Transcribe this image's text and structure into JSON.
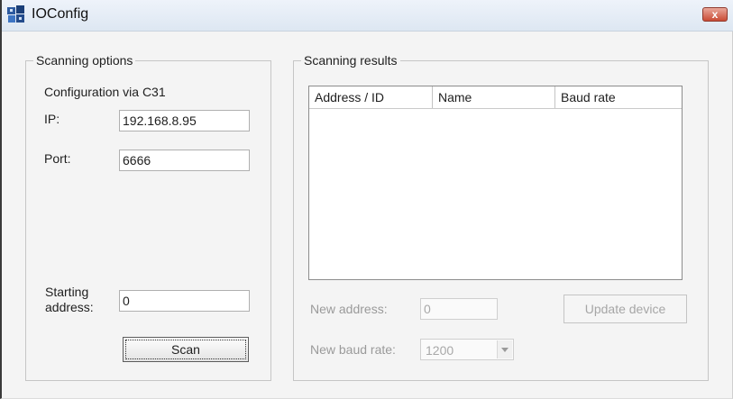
{
  "window": {
    "title": "IOConfig",
    "close_glyph": "x"
  },
  "scanning_options": {
    "legend": "Scanning options",
    "config_label": "Configuration via C31",
    "ip_label": "IP:",
    "ip_value": "192.168.8.95",
    "port_label": "Port:",
    "port_value": "6666",
    "starting_address_label_line1": "Starting",
    "starting_address_label_line2": "address:",
    "starting_address_value": "0",
    "scan_label": "Scan"
  },
  "scanning_results": {
    "legend": "Scanning results",
    "columns": [
      "Address / ID",
      "Name",
      "Baud rate"
    ],
    "rows": [],
    "new_address_label": "New address:",
    "new_address_value": "0",
    "update_device_label": "Update device",
    "new_baud_rate_label": "New baud rate:",
    "new_baud_rate_value": "1200"
  },
  "icons": {
    "app": "ioconfig-app-icon",
    "close": "close-icon",
    "dropdown": "chevron-down-icon"
  },
  "colors": {
    "close_button": "#c94b34",
    "titlebar": "#dde7f2"
  }
}
